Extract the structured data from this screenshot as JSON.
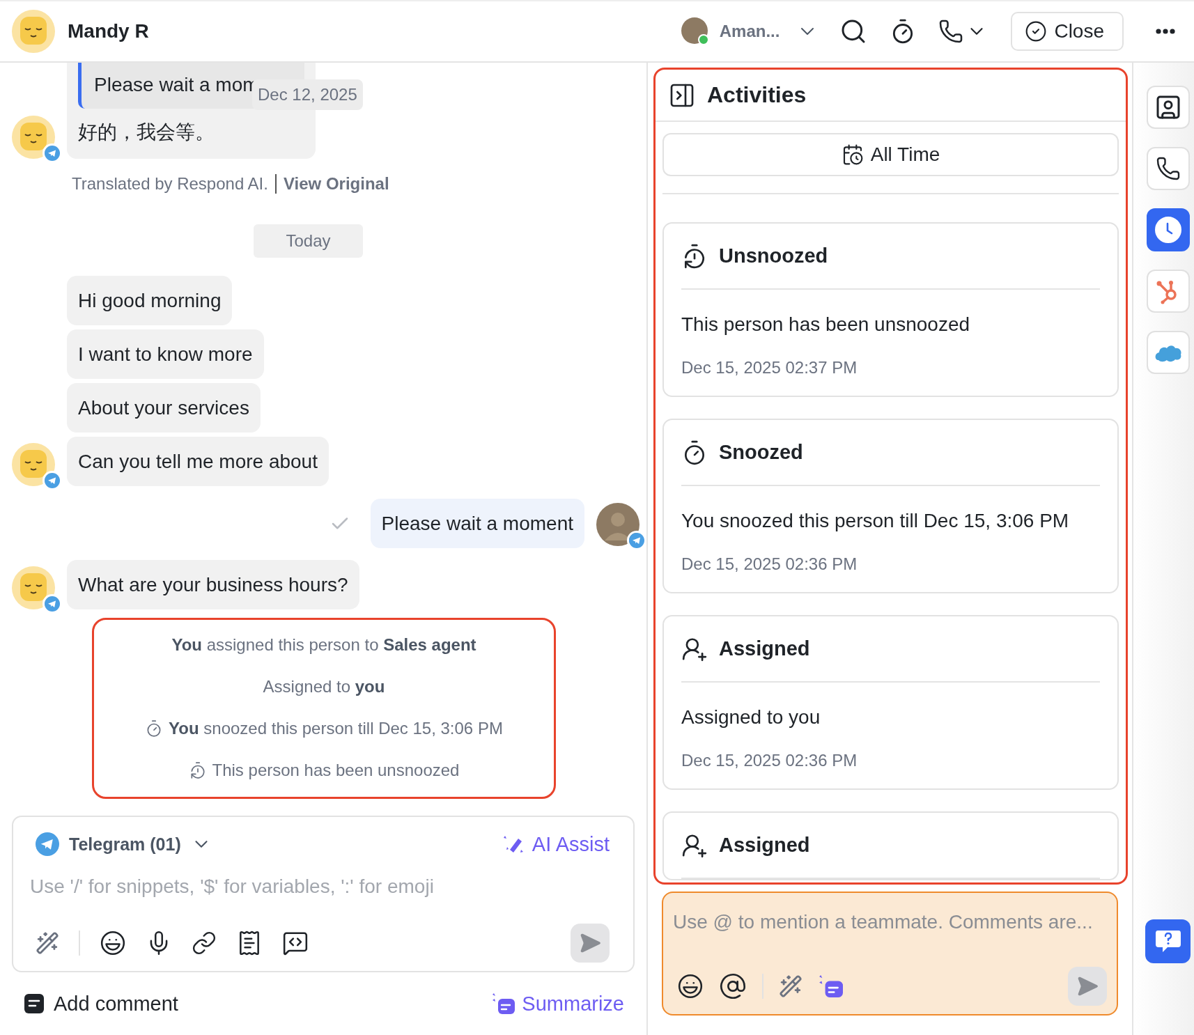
{
  "header": {
    "name": "Mandy R",
    "agent": "Aman...",
    "close": "Close"
  },
  "thread": [
    {
      "kind": "incoming",
      "quote": "Please wait a mom",
      "tooltip": "Dec 12, 2025",
      "messages": [
        "好的，我会等。"
      ]
    },
    {
      "kind": "translation",
      "text": "Translated by Respond AI.",
      "link": "View Original"
    },
    {
      "kind": "date",
      "text": "Today"
    },
    {
      "kind": "incoming",
      "messages": [
        "Hi good morning",
        "I want to know more",
        "About your services",
        "Can you tell me more about"
      ]
    },
    {
      "kind": "outgoing",
      "messages": [
        "Please wait a moment"
      ]
    },
    {
      "kind": "incoming",
      "messages": [
        "What are your business hours?"
      ]
    },
    {
      "kind": "events",
      "items": [
        {
          "kind": "plain",
          "text": "**You** assigned this person to **Sales agent**"
        },
        {
          "kind": "plain",
          "text": "Assigned to **you**"
        },
        {
          "kind": "snooze",
          "text": "**You** snoozed this person till Dec 15, 3:06 PM"
        },
        {
          "kind": "unsnooze",
          "text": "This person has been unsnoozed"
        }
      ]
    }
  ],
  "composer": {
    "channel": "Telegram (01)",
    "ai_assist": "AI Assist",
    "placeholder": "Use '/' for snippets, '$' for variables, ':' for emoji",
    "add_comment": "Add comment",
    "summarize": "Summarize"
  },
  "activities": {
    "title": "Activities",
    "filter": "All Time",
    "items": [
      {
        "kind": "unsnoozed",
        "title": "Unsnoozed",
        "text": "This person has been unsnoozed",
        "time": "Dec 15, 2025 02:37 PM"
      },
      {
        "kind": "snoozed",
        "title": "Snoozed",
        "text": "You snoozed this person till Dec 15, 3:06 PM",
        "time": "Dec 15, 2025 02:36 PM"
      },
      {
        "kind": "assigned",
        "title": "Assigned",
        "text": "Assigned to you",
        "time": "Dec 15, 2025 02:36 PM"
      },
      {
        "kind": "assigned",
        "title": "Assigned"
      }
    ],
    "comment_placeholder": "Use @ to mention a teammate. Comments are..."
  },
  "rail": [
    {
      "kind": "contact",
      "selected": false
    },
    {
      "kind": "phone",
      "selected": false
    },
    {
      "kind": "activity",
      "selected": true
    },
    {
      "kind": "hubspot",
      "selected": false
    },
    {
      "kind": "salesforce",
      "selected": false
    }
  ]
}
